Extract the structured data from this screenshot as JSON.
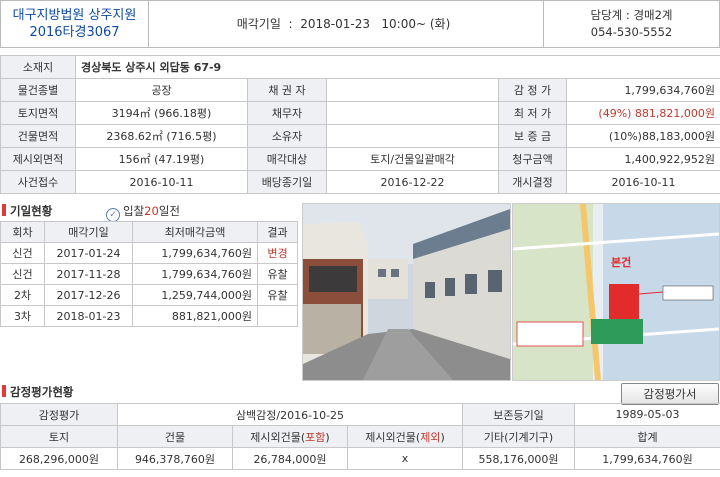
{
  "header": {
    "court_name": "대구지방법원 상주지원",
    "case_no": "2016타경3067",
    "sale_date_label": "매각기일",
    "sale_date_value": "2018-01-23   10:00~ (화)",
    "dept_label": "담당계",
    "dept_value": "경매2계",
    "phone": "054-530-5552"
  },
  "info": {
    "location_label": "소재지",
    "location_value": "경상북도 상주시 외답동 67-9",
    "rows": [
      {
        "l1": "물건종별",
        "v1": "공장",
        "l2": "채 권 자",
        "v2": "",
        "l3": "감 정 가",
        "v3": "1,799,634,760원"
      },
      {
        "l1": "토지면적",
        "v1": "3194㎡ (966.18평)",
        "l2": "채무자",
        "v2": "",
        "l3": "최 저 가",
        "v3": "(49%) 881,821,000원"
      },
      {
        "l1": "건물면적",
        "v1": "2368.62㎡ (716.5평)",
        "l2": "소유자",
        "v2": "",
        "l3": "보 증 금",
        "v3": "(10%)88,183,000원"
      },
      {
        "l1": "제시외면적",
        "v1": "156㎡ (47.19평)",
        "l2": "매각대상",
        "v2": "토지/건물일괄매각",
        "l3": "청구금액",
        "v3": "1,400,922,952원"
      },
      {
        "l1": "사건접수",
        "v1": "2016-10-11",
        "l2": "배당종기일",
        "v2": "2016-12-22",
        "l3": "개시결정",
        "v3": "2016-10-11"
      }
    ]
  },
  "history": {
    "title": "기일현황",
    "badge_prefix": "입찰",
    "badge_count": "20",
    "badge_suffix": "일전",
    "headers": [
      "회차",
      "매각기일",
      "최저매각금액",
      "결과"
    ],
    "rows": [
      {
        "round": "신건",
        "date": "2017-01-24",
        "price": "1,799,634,760원",
        "result": "변경"
      },
      {
        "round": "신건",
        "date": "2017-11-28",
        "price": "1,799,634,760원",
        "result": "유찰"
      },
      {
        "round": "2차",
        "date": "2017-12-26",
        "price": "1,259,744,000원",
        "result": "유찰"
      },
      {
        "round": "3차",
        "date": "2018-01-23",
        "price": "881,821,000원",
        "result": ""
      }
    ]
  },
  "map": {
    "marker_label": "본건"
  },
  "appraisal": {
    "title": "감정평가현황",
    "button_label": "감정평가서",
    "org_label": "감정평가",
    "org_value": "삼백감정/2016-10-25",
    "reg_label": "보존등기일",
    "reg_value": "1989-05-03",
    "col_land": "토지",
    "col_building": "건물",
    "col_extra_incl_prefix": "제시외건물(",
    "col_extra_incl_hl": "포함",
    "col_extra_excl_prefix": "제시외건물(",
    "col_extra_excl_hl": "제외",
    "col_suffix": ")",
    "col_other": "기타(기계기구)",
    "col_total": "합계",
    "val_land": "268,296,000원",
    "val_building": "946,378,760원",
    "val_extra_incl": "26,784,000원",
    "val_extra_excl": "x",
    "val_other": "558,176,000원",
    "val_total": "1,799,634,760원"
  },
  "colors": {
    "accent_blue": "#0e49a8",
    "accent_red": "#c0392b",
    "header_bg": "#eef0f4"
  }
}
